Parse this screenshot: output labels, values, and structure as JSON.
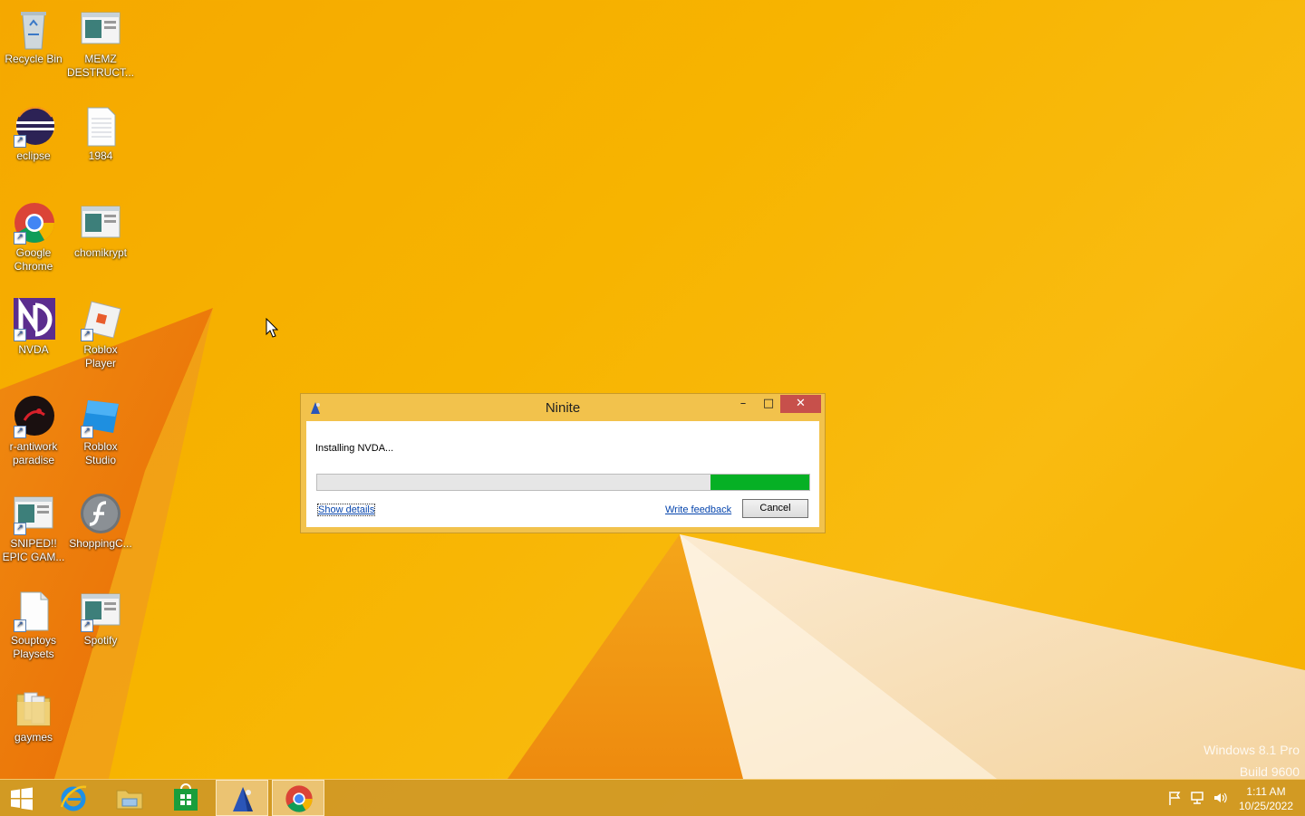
{
  "desktop_icons": [
    {
      "label": "Recycle Bin",
      "icon": "recycle-bin-icon"
    },
    {
      "label": "MEMZ DESTRUCT...",
      "icon": "window-app-icon"
    },
    {
      "label": "eclipse",
      "icon": "eclipse-icon"
    },
    {
      "label": "1984",
      "icon": "text-document-icon"
    },
    {
      "label": "Google Chrome",
      "icon": "chrome-icon"
    },
    {
      "label": "chomikrypt",
      "icon": "window-app-icon"
    },
    {
      "label": "NVDA",
      "icon": "nvda-icon"
    },
    {
      "label": "Roblox Player",
      "icon": "roblox-icon"
    },
    {
      "label": "r-antiwork paradise",
      "icon": "game-icon"
    },
    {
      "label": "Roblox Studio",
      "icon": "roblox-studio-icon"
    },
    {
      "label": "SNIPED!! EPIC GAM...",
      "icon": "window-app-icon"
    },
    {
      "label": "ShoppingC...",
      "icon": "flash-icon"
    },
    {
      "label": "Souptoys Playsets",
      "icon": "document-icon"
    },
    {
      "label": "Spotify",
      "icon": "window-app-icon"
    },
    {
      "label": "gaymes",
      "icon": "folder-icon"
    }
  ],
  "dialog": {
    "title": "Ninite",
    "status": "Installing NVDA...",
    "progress_start": 0.8,
    "progress_end": 1.0,
    "show_details": "Show details",
    "write_feedback": "Write feedback",
    "cancel": "Cancel",
    "colors": {
      "progress": "#06b025",
      "close": "#c7504b"
    }
  },
  "taskbar": {
    "items": [
      "start-icon",
      "internet-explorer-icon",
      "file-explorer-icon",
      "store-icon",
      "ninite-icon",
      "chrome-icon"
    ],
    "active": "ninite-icon",
    "time": "1:11 AM",
    "date": "10/25/2022"
  },
  "watermark": {
    "line1": "Windows 8.1 Pro",
    "line2": "Build 9600"
  }
}
